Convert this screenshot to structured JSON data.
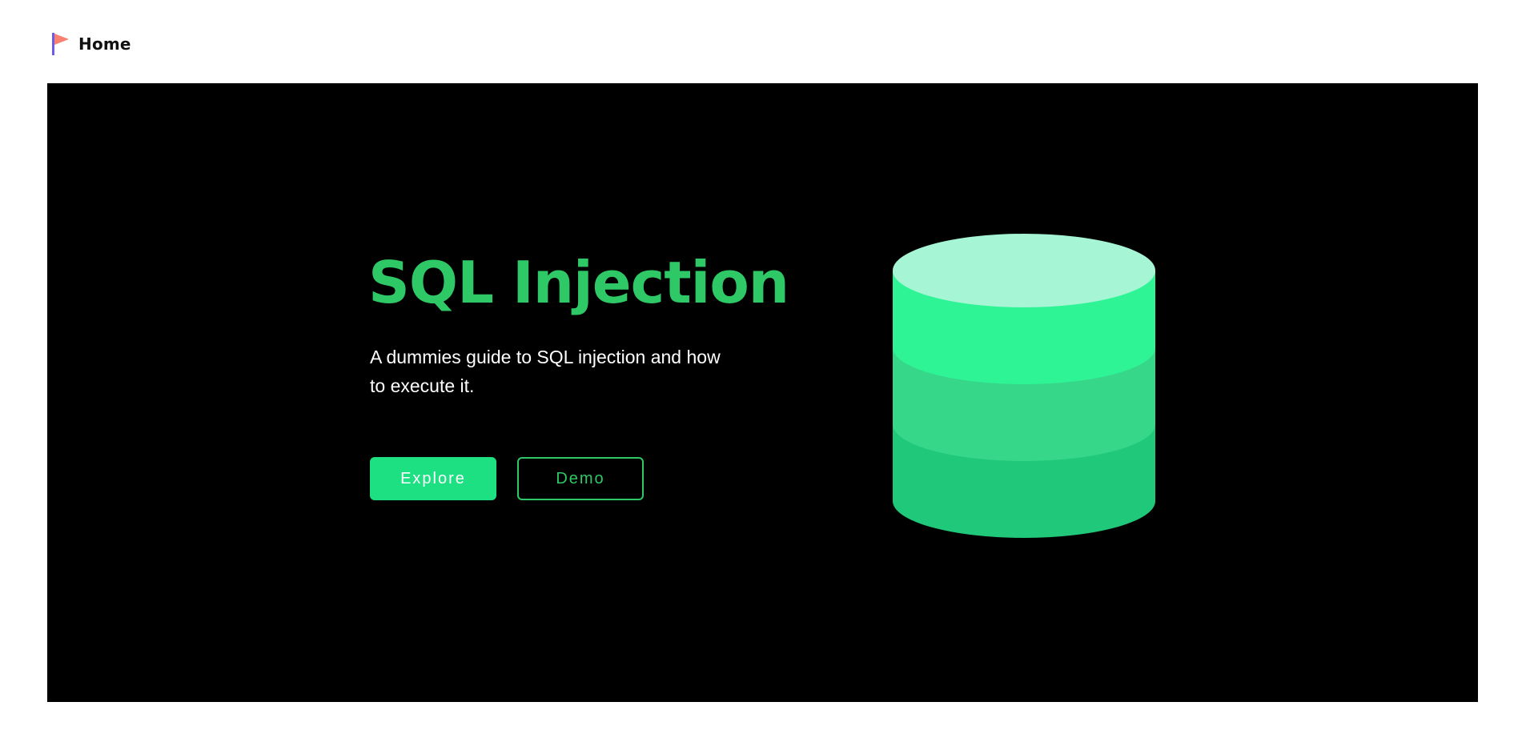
{
  "nav": {
    "home_label": "Home",
    "icon": "flag-icon"
  },
  "hero": {
    "title": "SQL Injection",
    "subtitle": "A dummies guide to SQL injection and how to execute it.",
    "buttons": {
      "explore_label": "Explore",
      "demo_label": "Demo"
    },
    "illustration_icon": "database-icon"
  },
  "colors": {
    "hero_background": "#000000",
    "title": "#2ec866",
    "explore_button": "#1de083",
    "demo_border": "#2ec866",
    "db_top": "#a6f5d4",
    "db_layer_1": "#2ef496",
    "db_layer_2": "#36d789",
    "db_layer_3": "#20c87a"
  }
}
